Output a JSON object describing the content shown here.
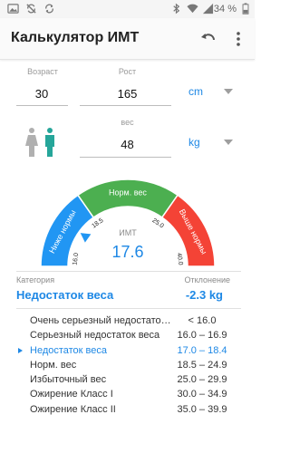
{
  "status": {
    "icons": [
      "gallery-icon",
      "sync-off-icon",
      "sync-icon",
      "bluetooth-icon",
      "wifi-icon",
      "signal-icon",
      "battery-icon"
    ],
    "battery_text": "34 %"
  },
  "appbar": {
    "title": "Калькулятор ИМТ",
    "undo_icon": "undo-icon",
    "more_icon": "more-vert-icon"
  },
  "inputs": {
    "age": {
      "label": "Возраст",
      "value": "30"
    },
    "height": {
      "label": "Рост",
      "value": "165",
      "unit": "cm"
    },
    "weight": {
      "label": "вес",
      "value": "48",
      "unit": "kg"
    },
    "gender_icon": "male-female-icon"
  },
  "gauge": {
    "title": "ИМТ",
    "value": "17.6",
    "bmi": 17.6,
    "segments": [
      {
        "label": "Ниже нормы",
        "color": "#2196f3"
      },
      {
        "label": "Норм. вес",
        "color": "#4caf50"
      },
      {
        "label": "Выше нормы",
        "color": "#f44336"
      }
    ],
    "ticks": [
      "16.0",
      "18.5",
      "25.0",
      "40.0"
    ]
  },
  "result": {
    "category_label": "Категория",
    "category_value": "Недостаток веса",
    "deviation_label": "Отклонение",
    "deviation_value": "-2.3 kg"
  },
  "table": {
    "rows": [
      {
        "name": "Очень серьезный недостаток веса",
        "range": "< 16.0",
        "active": false
      },
      {
        "name": "Серьезный недостаток веса",
        "range": "16.0 – 16.9",
        "active": false
      },
      {
        "name": "Недостаток веса",
        "range": "17.0 – 18.4",
        "active": true
      },
      {
        "name": "Норм. вес",
        "range": "18.5 – 24.9",
        "active": false
      },
      {
        "name": "Избыточный вес",
        "range": "25.0 – 29.9",
        "active": false
      },
      {
        "name": "Ожирение Класс I",
        "range": "30.0 – 34.9",
        "active": false
      },
      {
        "name": "Ожирение Класс II",
        "range": "35.0 – 39.9",
        "active": false
      }
    ]
  },
  "colors": {
    "accent": "#1e88e5",
    "under": "#2196f3",
    "normal": "#4caf50",
    "over": "#f44336"
  }
}
